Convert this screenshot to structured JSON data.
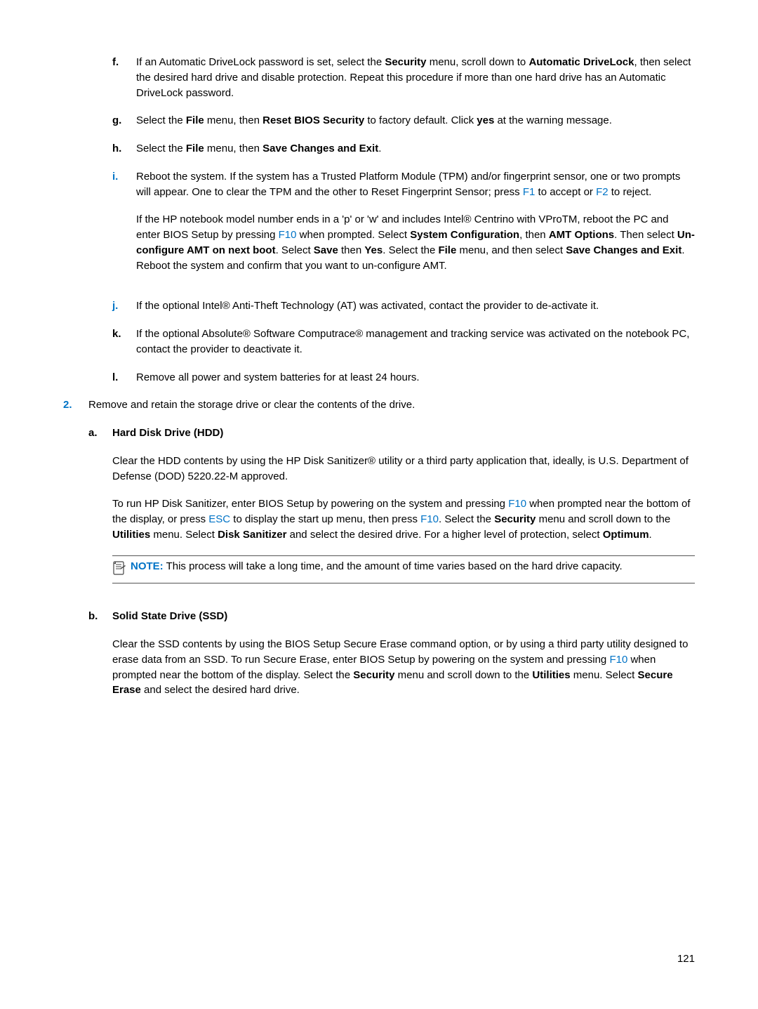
{
  "items": {
    "f": {
      "marker": "f.",
      "text": "If an Automatic DriveLock password is set, select the <b>Security</b> menu, scroll down to <b>Automatic DriveLock</b>, then select the desired hard drive and disable protection. Repeat this procedure if more than one hard drive has an Automatic DriveLock password."
    },
    "g": {
      "marker": "g.",
      "text": "Select the <b>File</b> menu, then <b>Reset BIOS Security</b> to factory default. Click <b>yes</b> at the warning message."
    },
    "h": {
      "marker": "h.",
      "text": "Select the <b>File</b> menu, then <b>Save Changes and Exit</b>."
    },
    "i": {
      "marker": "i.",
      "p1": "Reboot the system. If the system has a Trusted Platform Module (TPM) and/or fingerprint sensor, one or two prompts will appear. One to clear the TPM and the other to Reset Fingerprint Sensor; press <span class='key'>F1</span> to accept or <span class='key'>F2</span> to reject.",
      "p2": "If the HP notebook model number ends in a 'p' or 'w' and includes Intel® Centrino with VProTM, reboot the PC and enter BIOS Setup by pressing <span class='key'>F10</span> when prompted. Select <b>System Configuration</b>, then <b>AMT Options</b>. Then select <b>Un-configure AMT on next boot</b>. Select <b>Save</b> then <b>Yes</b>. Select the <b>File</b> menu, and then select <b>Save Changes and Exit</b>. Reboot the system and confirm that you want to un-configure AMT."
    },
    "j": {
      "marker": "j.",
      "text": "If the optional Intel® Anti-Theft Technology (AT) was activated, contact the provider to de-activate it."
    },
    "k": {
      "marker": "k.",
      "text": "If the optional Absolute® Software Computrace® management and tracking service was activated on the notebook PC, contact the provider to deactivate it."
    },
    "l": {
      "marker": "l.",
      "text": "Remove all power and system batteries for at least 24 hours."
    },
    "step2": {
      "marker": "2.",
      "text": "Remove and retain the storage drive or clear the contents of the drive."
    },
    "a": {
      "marker": "a.",
      "heading": "Hard Disk Drive (HDD)",
      "p1": "Clear the HDD contents by using the HP Disk Sanitizer® utility or a third party application that, ideally, is U.S. Department of Defense (DOD) 5220.22-M approved.",
      "p2": "To run HP Disk Sanitizer, enter BIOS Setup by powering on the system and pressing <span class='key'>F10</span> when prompted near the bottom of the display, or press <span class='key'>ESC</span> to display the start up menu, then press <span class='key'>F10</span>. Select the <b>Security</b> menu and scroll down to the <b>Utilities</b> menu. Select <b>Disk Sanitizer</b> and select the desired drive. For a higher level of protection, select <b>Optimum</b>."
    },
    "note": {
      "label": "NOTE:",
      "text": "This process will take a long time, and the amount of time varies based on the hard drive capacity."
    },
    "b": {
      "marker": "b.",
      "heading": "Solid State Drive (SSD)",
      "p1": "Clear the SSD contents by using the BIOS Setup Secure Erase command option, or by using a third party utility designed to erase data from an SSD. To run Secure Erase, enter BIOS Setup by powering on the system and pressing <span class='key'>F10</span> when prompted near the bottom of the display. Select the <b>Security</b> menu and scroll down to the <b>Utilities</b> menu. Select <b>Secure Erase</b> and select the desired hard drive."
    }
  },
  "pageNumber": "121"
}
